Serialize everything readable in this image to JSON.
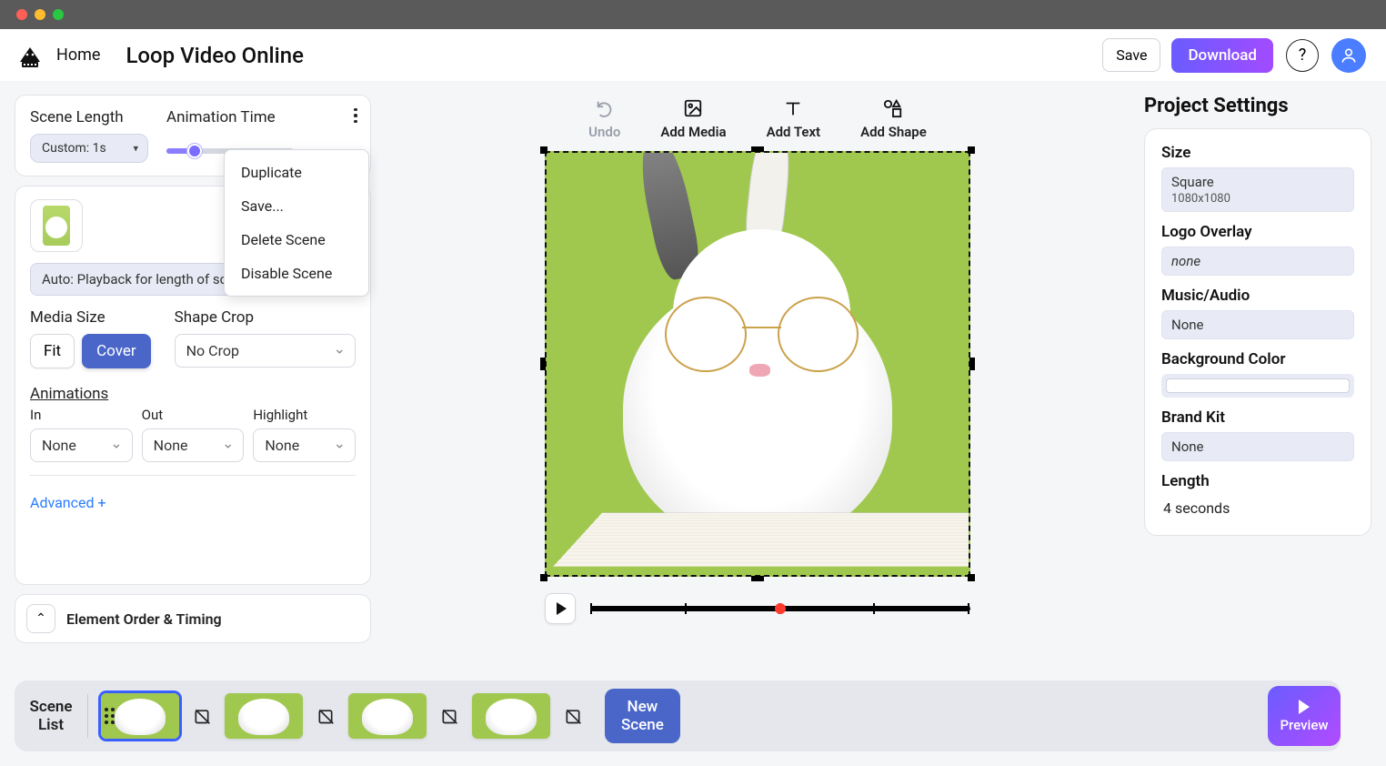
{
  "header": {
    "home": "Home",
    "title": "Loop Video Online",
    "save": "Save",
    "download": "Download"
  },
  "scene_panel": {
    "scene_length_label": "Scene Length",
    "animation_time_label": "Animation Time",
    "scene_length_value": "Custom: 1s"
  },
  "context_menu": {
    "duplicate": "Duplicate",
    "save": "Save...",
    "delete": "Delete Scene",
    "disable": "Disable Scene"
  },
  "media_panel": {
    "playback_mode": "Auto: Playback for length of scene",
    "media_size_label": "Media Size",
    "fit": "Fit",
    "cover": "Cover",
    "shape_crop_label": "Shape Crop",
    "shape_crop_value": "No Crop",
    "animations_label": "Animations",
    "in_label": "In",
    "out_label": "Out",
    "highlight_label": "Highlight",
    "in_value": "None",
    "out_value": "None",
    "highlight_value": "None",
    "advanced": "Advanced +",
    "order_timing": "Element Order & Timing"
  },
  "toolbar": {
    "undo": "Undo",
    "add_media": "Add Media",
    "add_text": "Add Text",
    "add_shape": "Add Shape"
  },
  "project_settings": {
    "title": "Project Settings",
    "size_label": "Size",
    "size_value": "Square",
    "size_sub": "1080x1080",
    "logo_label": "Logo Overlay",
    "logo_value": "none",
    "music_label": "Music/Audio",
    "music_value": "None",
    "bg_label": "Background Color",
    "brand_label": "Brand Kit",
    "brand_value": "None",
    "length_label": "Length",
    "length_value": "4 seconds"
  },
  "bottom": {
    "scene_list": "Scene\nList",
    "new_scene": "New\nScene",
    "preview": "Preview"
  }
}
